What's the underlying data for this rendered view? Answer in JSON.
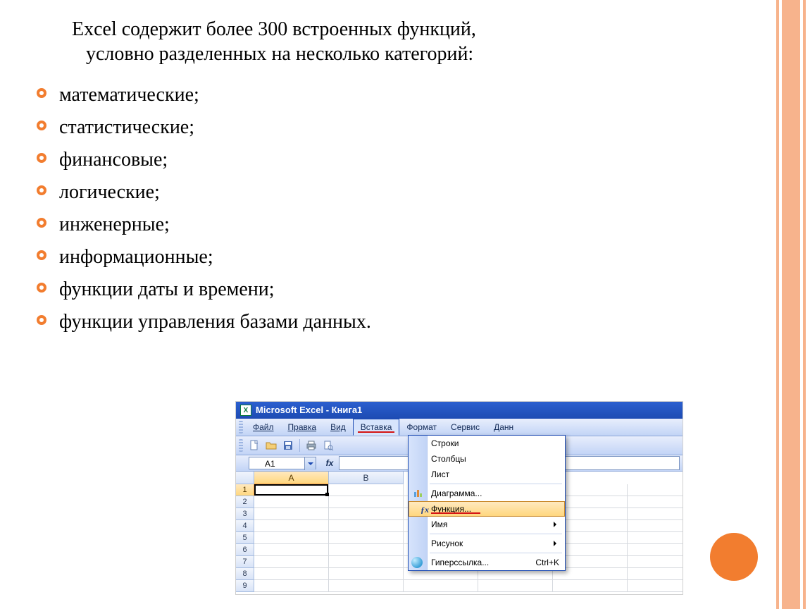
{
  "intro_line1": "Excel содержит более 300 встроенных функций,",
  "intro_line2": "условно разделенных на несколько категорий:",
  "categories": [
    "математические;",
    "статистические;",
    "финансовые;",
    "логические;",
    "инженерные;",
    "информационные;",
    "функции даты и времени;",
    "функции управления базами данных."
  ],
  "excel": {
    "logo": "X",
    "title": "Microsoft Excel - Книга1",
    "menus": {
      "file": "Файл",
      "edit": "Правка",
      "view": "Вид",
      "insert": "Вставка",
      "format": "Формат",
      "tools": "Сервис",
      "data": "Данн"
    },
    "namebox": "A1",
    "fx_label": "fx",
    "columns": [
      "A",
      "B"
    ],
    "rows": [
      "1",
      "2",
      "3",
      "4",
      "5",
      "6",
      "7",
      "8",
      "9"
    ],
    "dropdown": {
      "rows": "Строки",
      "cols": "Столбцы",
      "sheet": "Лист",
      "chart": "Диаграмма...",
      "func": "Функция...",
      "name": "Имя",
      "picture": "Рисунок",
      "hyperlink": "Гиперссылка...",
      "shortcut": "Ctrl+K"
    }
  }
}
